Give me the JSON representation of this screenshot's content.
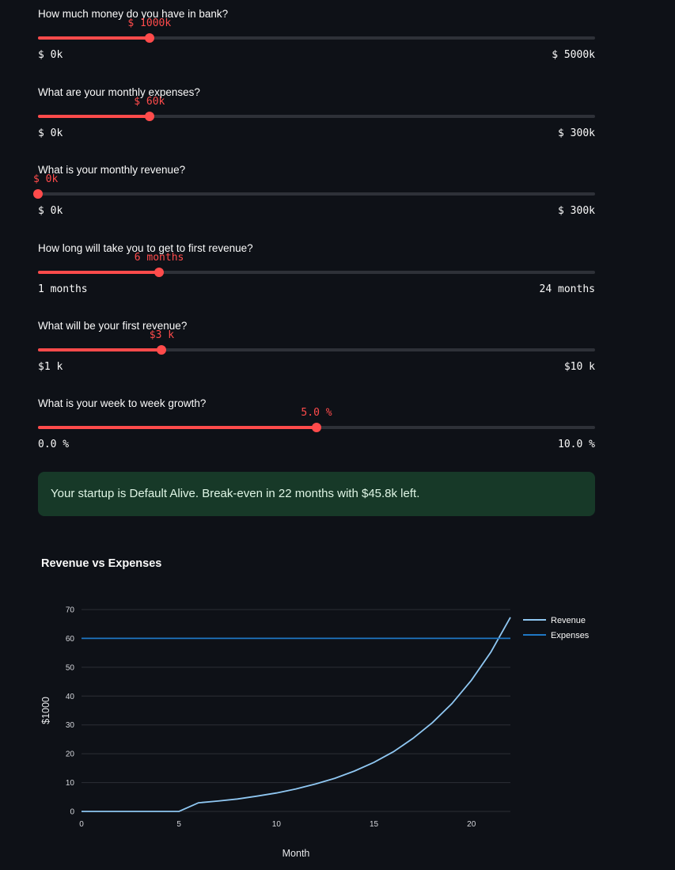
{
  "sliders": [
    {
      "question": "How much money do you have in bank?",
      "value_label": "$ 1000k",
      "min_label": "$ 0k",
      "max_label": "$ 5000k",
      "fraction": 0.2
    },
    {
      "question": "What are your monthly expenses?",
      "value_label": "$ 60k",
      "min_label": "$ 0k",
      "max_label": "$ 300k",
      "fraction": 0.2
    },
    {
      "question": "What is your monthly revenue?",
      "value_label": "$ 0k",
      "min_label": "$ 0k",
      "max_label": "$ 300k",
      "fraction": 0.0
    },
    {
      "question": "How long will take you to get to first revenue?",
      "value_label": "6 months",
      "min_label": "1 months",
      "max_label": "24 months",
      "fraction": 0.2174
    },
    {
      "question": "What will be your first revenue?",
      "value_label": "$3 k",
      "min_label": "$1 k",
      "max_label": "$10 k",
      "fraction": 0.2222
    },
    {
      "question": "What is your week to week growth?",
      "value_label": "5.0 %",
      "min_label": "0.0 %",
      "max_label": "10.0 %",
      "fraction": 0.5
    }
  ],
  "alert": {
    "text": "Your startup is Default Alive. Break-even in 22 months with $45.8k left."
  },
  "chart_data": {
    "type": "line",
    "title": "Revenue vs Expenses",
    "xlabel": "Month",
    "ylabel": "$1000",
    "xlim": [
      0,
      22
    ],
    "ylim": [
      0,
      70
    ],
    "xticks": [
      0,
      5,
      10,
      15,
      20
    ],
    "yticks": [
      0,
      10,
      20,
      30,
      40,
      50,
      60,
      70
    ],
    "legend": "right",
    "series": [
      {
        "name": "Revenue",
        "color": "#8fc7f2",
        "x": [
          0,
          1,
          2,
          3,
          4,
          5,
          6,
          7,
          8,
          9,
          10,
          11,
          12,
          13,
          14,
          15,
          16,
          17,
          18,
          19,
          20,
          21,
          22
        ],
        "y": [
          0,
          0,
          0,
          0,
          0,
          0,
          3,
          3.6,
          4.3,
          5.3,
          6.4,
          7.8,
          9.5,
          11.5,
          14,
          17,
          20.7,
          25.3,
          30.8,
          37.4,
          45.5,
          55.3,
          67.3
        ]
      },
      {
        "name": "Expenses",
        "color": "#1f77c4",
        "x": [
          0,
          1,
          2,
          3,
          4,
          5,
          6,
          7,
          8,
          9,
          10,
          11,
          12,
          13,
          14,
          15,
          16,
          17,
          18,
          19,
          20,
          21,
          22
        ],
        "y": [
          60,
          60,
          60,
          60,
          60,
          60,
          60,
          60,
          60,
          60,
          60,
          60,
          60,
          60,
          60,
          60,
          60,
          60,
          60,
          60,
          60,
          60,
          60
        ]
      }
    ]
  }
}
